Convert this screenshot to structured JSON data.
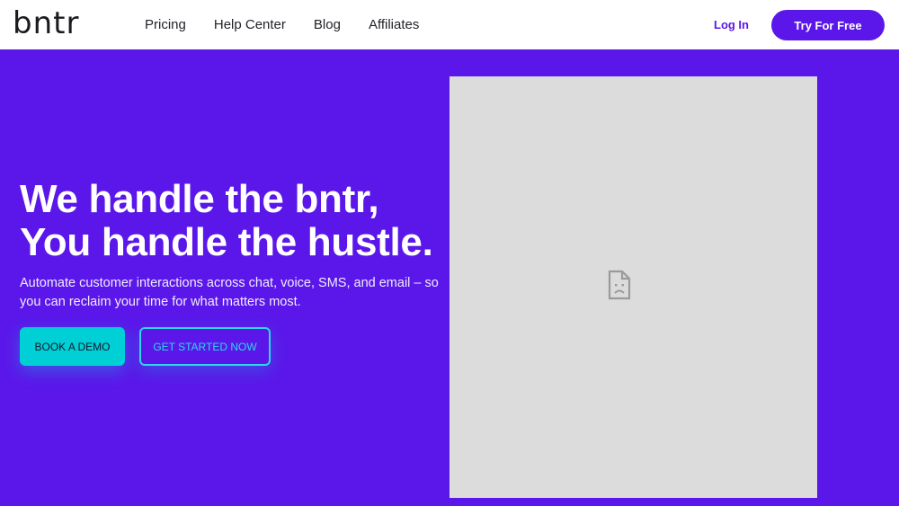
{
  "header": {
    "logo": "bntr",
    "nav": [
      "Pricing",
      "Help Center",
      "Blog",
      "Affiliates"
    ],
    "login": "Log In",
    "cta": "Try For Free"
  },
  "hero": {
    "title_line1": "We handle the bntr,",
    "title_line2": "You handle the hustle.",
    "subtitle": "Automate customer interactions across chat, voice, SMS, and email – so you can reclaim your time for what matters most.",
    "primary_button": "BOOK A DEMO",
    "secondary_button": "GET STARTED NOW"
  },
  "media": {
    "icon": "broken-image-icon"
  },
  "colors": {
    "brand": "#5b17ea",
    "accent": "#00cfd6",
    "placeholder": "#dcdcdc"
  }
}
